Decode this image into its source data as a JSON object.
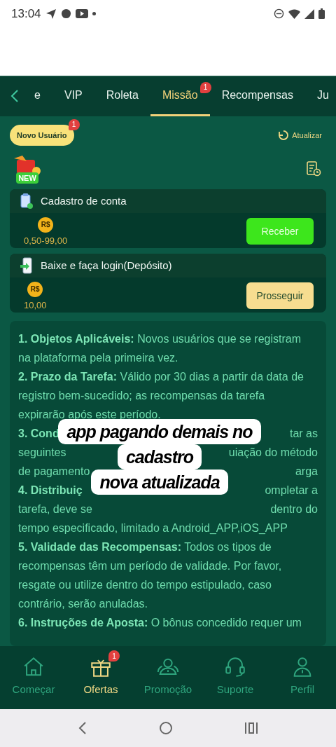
{
  "status_bar": {
    "time": "13:04"
  },
  "tabs": [
    {
      "label": "e",
      "selected": false
    },
    {
      "label": "VIP",
      "selected": false
    },
    {
      "label": "Roleta",
      "selected": false
    },
    {
      "label": "Missão",
      "selected": true,
      "badge": "1"
    },
    {
      "label": "Recompensas",
      "selected": false
    },
    {
      "label": "Ju",
      "selected": false
    }
  ],
  "filter_chip": {
    "label": "Novo Usuário",
    "badge": "1"
  },
  "refresh": {
    "label": "Atualizar"
  },
  "new_badge": "NEW",
  "tasks": [
    {
      "title": "Cadastro de conta",
      "currency": "R$",
      "amount": "0,50-99,00",
      "button": "Receber",
      "kind": "claim"
    },
    {
      "title": "Baixe e faça login(Depósito)",
      "currency": "R$",
      "amount": "10,00",
      "button": "Prosseguir",
      "kind": "proceed"
    }
  ],
  "rules": [
    [
      "**1. Objetos Aplicáveis:** Novos usuários que se registram"
    ],
    [
      "na plataforma pela primeira vez."
    ],
    [
      "**2. Prazo da Tarefa:** Válido por 30 dias a partir da data de"
    ],
    [
      "registro bem-sucedido; as recompensas da tarefa"
    ],
    [
      "expirarão após este período."
    ],
    [
      "**3. Cond**",
      "tar as"
    ],
    [
      "seguintes",
      "uiação do método"
    ],
    [
      "de pagamento",
      "arga"
    ],
    [
      "**4. Distribuiç**",
      "ompletar a"
    ],
    [
      "tarefa, deve se",
      "dentro do"
    ],
    [
      "tempo especificado, limitado a Android_APP,iOS_APP"
    ],
    [
      "**5. Validade das Recompensas:** Todos os tipos de"
    ],
    [
      "recompensas têm um período de validade. Por favor,"
    ],
    [
      "resgate ou utilize dentro do tempo estipulado, caso"
    ],
    [
      "contrário, serão anuladas."
    ],
    [
      "**6. Instruções de Aposta:** O bônus concedido requer um"
    ]
  ],
  "caption": [
    "app pagando demais no",
    "cadastro",
    "nova atualizada"
  ],
  "bottom_nav": [
    {
      "label": "Começar",
      "selected": false
    },
    {
      "label": "Ofertas",
      "selected": true,
      "badge": "1"
    },
    {
      "label": "Promoção",
      "selected": false
    },
    {
      "label": "Suporte",
      "selected": false
    },
    {
      "label": "Perfil",
      "selected": false
    }
  ]
}
